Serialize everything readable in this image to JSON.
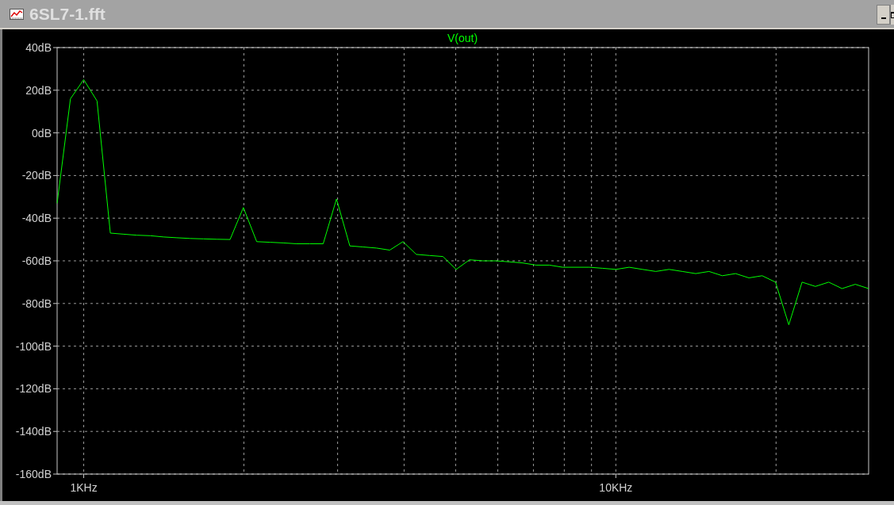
{
  "window": {
    "title": "6SL7-1.fft"
  },
  "plot": {
    "chart_data": {
      "type": "line",
      "grid": true,
      "ylim": [
        -160,
        40
      ],
      "categories": [
        null,
        null,
        "1KHz",
        null,
        null,
        null,
        null,
        null,
        null,
        null,
        null,
        null,
        null,
        null,
        null,
        null,
        null,
        null,
        null,
        null,
        null,
        null,
        null,
        null,
        null,
        null,
        null,
        null,
        null,
        null,
        null,
        null,
        null,
        null,
        null,
        null,
        null,
        null,
        null,
        null,
        null,
        null,
        "10KHz",
        null,
        null,
        null,
        null,
        null,
        null,
        null,
        null,
        null,
        null,
        null,
        null,
        null,
        null,
        null,
        null,
        null,
        null,
        null
      ],
      "yticks": [
        {
          "value": 40,
          "label": "40dB"
        },
        {
          "value": 20,
          "label": "20dB"
        },
        {
          "value": 0,
          "label": "0dB"
        },
        {
          "value": -20,
          "label": "-20dB"
        },
        {
          "value": -40,
          "label": "-40dB"
        },
        {
          "value": -60,
          "label": "-60dB"
        },
        {
          "value": -80,
          "label": "-80dB"
        },
        {
          "value": -100,
          "label": "-100dB"
        },
        {
          "value": -120,
          "label": "-120dB"
        },
        {
          "value": -140,
          "label": "-140dB"
        },
        {
          "value": -160,
          "label": "-160dB"
        }
      ],
      "series": [
        {
          "name": "V(out)",
          "color": "#00ff00",
          "values": [
            -33,
            16,
            25,
            15,
            -47,
            -47.5,
            -48,
            -48.2,
            -48.8,
            -49.2,
            -49.5,
            -49.7,
            -49.9,
            -50,
            -35,
            -51,
            -51.3,
            -51.6,
            -52,
            -52,
            -52,
            -31,
            -53,
            -53.5,
            -54,
            -55,
            -51,
            -57,
            -57.5,
            -58,
            -64,
            -59.5,
            -60,
            -60,
            -60.5,
            -61,
            -62,
            -62,
            -63,
            -63,
            -63,
            -63.5,
            -64,
            -63,
            -64,
            -65,
            -64,
            -65,
            -66,
            -65,
            -67,
            -66,
            -68,
            -67,
            -70,
            -90,
            -70,
            -72,
            -70,
            -73,
            -71,
            -73
          ]
        }
      ]
    }
  }
}
